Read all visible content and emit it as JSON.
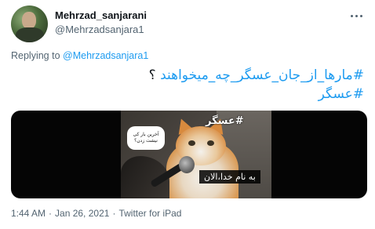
{
  "author": {
    "display_name": "Mehrzad_sanjarani",
    "handle": "@Mehrzadsanjara1",
    "avatar_icon": "user-avatar"
  },
  "more_icon": "more-horizontal-icon",
  "reply": {
    "prefix": "Replying to",
    "mention": "@Mehrzadsanjara1"
  },
  "tweet": {
    "line1_hashtag": "#مارها_از_جان_عسگر_چه_میخواهند",
    "line1_suffix": " ؟",
    "line2_hashtag": "#عسگر"
  },
  "media": {
    "overlay_hashtag": "#عسگر",
    "bubble_text": "آخرین بار کی نیشت زدن؟",
    "subtitle": "به نام خدا،الان"
  },
  "meta": {
    "time": "1:44 AM",
    "date": "Jan 26, 2021",
    "source": "Twitter for iPad",
    "separator": "·"
  }
}
